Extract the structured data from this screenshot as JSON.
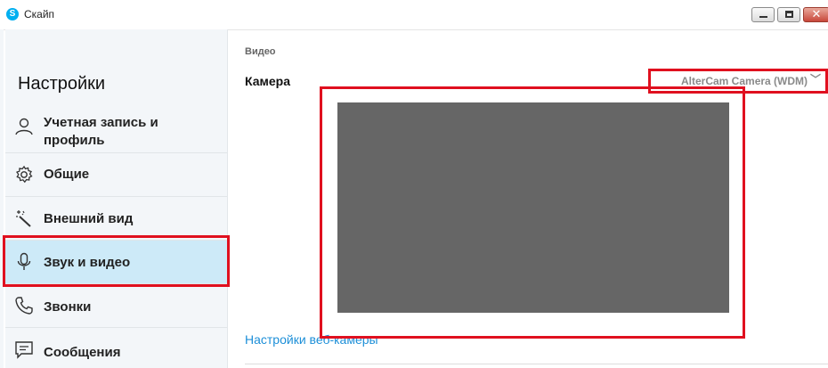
{
  "window": {
    "title": "Скайп",
    "app_icon_letter": "S",
    "close_glyph": "✕"
  },
  "sidebar": {
    "heading": "Настройки",
    "items": [
      {
        "label_line1": "Учетная запись и",
        "label_line2": "профиль",
        "icon": "person-icon"
      },
      {
        "label": "Общие",
        "icon": "gear-icon"
      },
      {
        "label": "Внешний вид",
        "icon": "magic-wand-icon"
      },
      {
        "label": "Звук и видео",
        "icon": "microphone-icon",
        "active": true
      },
      {
        "label": "Звонки",
        "icon": "phone-icon"
      },
      {
        "label": "Сообщения",
        "icon": "message-icon"
      }
    ]
  },
  "main": {
    "section_label": "Видео",
    "camera_label": "Камера",
    "camera_select": {
      "value": "AlterCam Camera (WDM)",
      "chevron": "﹀"
    },
    "webcam_settings_link": "Настройки веб-камеры"
  },
  "colors": {
    "accent": "#00aff0",
    "highlight": "#e0101f",
    "active_item_bg": "#cdeaf8",
    "preview_bg": "#666666",
    "link": "#1d8fd8"
  }
}
